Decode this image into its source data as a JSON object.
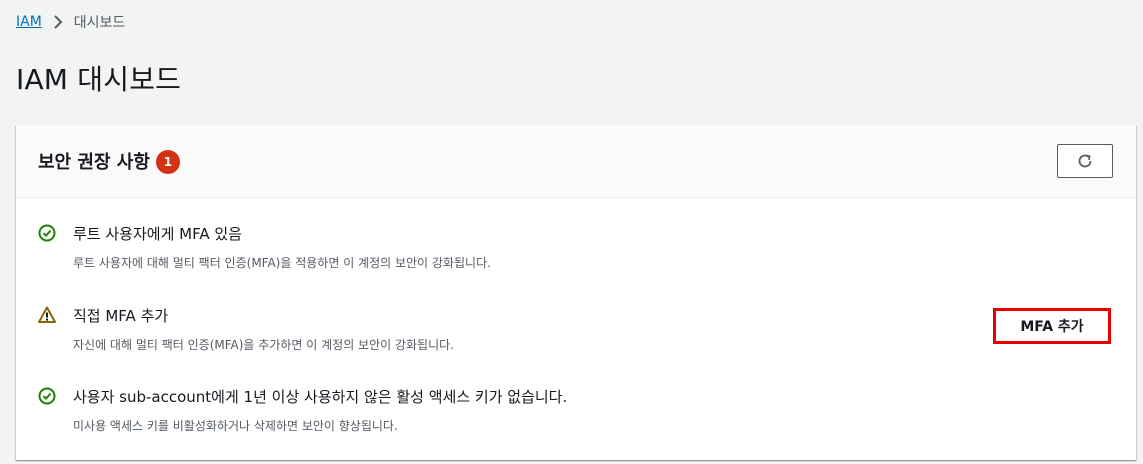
{
  "breadcrumb": {
    "root": "IAM",
    "current": "대시보드"
  },
  "page_title": "IAM 대시보드",
  "panel": {
    "title": "보안 권장 사항",
    "badge_count": "1"
  },
  "recommendations": [
    {
      "status": "success",
      "icon": "check-circle-icon",
      "title": "루트 사용자에게 MFA 있음",
      "description": "루트 사용자에 대해 멀티 팩터 인증(MFA)을 적용하면 이 계정의 보안이 강화됩니다."
    },
    {
      "status": "warning",
      "icon": "warning-triangle-icon",
      "title": "직접 MFA 추가",
      "description": "자신에 대해 멀티 팩터 인증(MFA)을 추가하면 이 계정의 보안이 강화됩니다.",
      "action_label": "MFA 추가"
    },
    {
      "status": "success",
      "icon": "check-circle-icon",
      "title": "사용자 sub-account에게 1년 이상 사용하지 않은 활성 액세스 키가 없습니다.",
      "description": "미사용 액세스 키를 비활성화하거나 삭제하면 보안이 향상됩니다."
    }
  ],
  "colors": {
    "success": "#1d8102",
    "warning": "#8d6605",
    "badge": "#d13212",
    "highlight": "#e80000",
    "link": "#0073bb"
  }
}
